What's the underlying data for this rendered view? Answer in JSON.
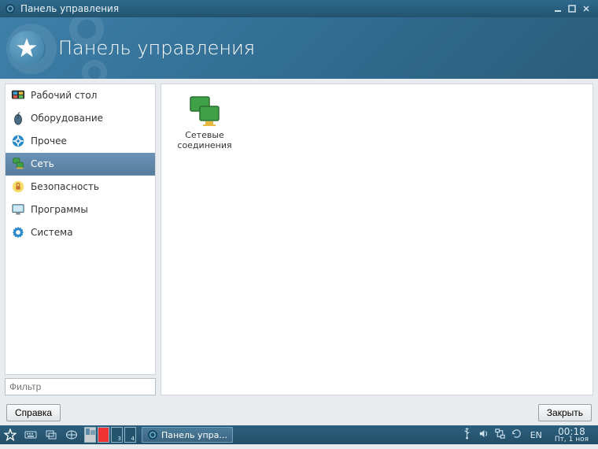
{
  "window": {
    "title": "Панель управления"
  },
  "banner": {
    "title": "Панель управления"
  },
  "sidebar": {
    "items": [
      {
        "label": "Рабочий стол",
        "icon": "desktop-icon"
      },
      {
        "label": "Оборудование",
        "icon": "mouse-icon"
      },
      {
        "label": "Прочее",
        "icon": "gear-icon"
      },
      {
        "label": "Сеть",
        "icon": "network-icon",
        "active": true
      },
      {
        "label": "Безопасность",
        "icon": "shield-icon"
      },
      {
        "label": "Программы",
        "icon": "display-icon"
      },
      {
        "label": "Система",
        "icon": "cog-icon"
      }
    ],
    "filter_placeholder": "Фильтр"
  },
  "main": {
    "items": [
      {
        "label_line1": "Сетевые",
        "label_line2": "соединения"
      }
    ]
  },
  "buttons": {
    "help": "Справка",
    "close": "Закрыть"
  },
  "taskbar": {
    "active_task": "Панель упра...",
    "lang": "EN",
    "time": "00:18",
    "date": "Пт, 1 ноя"
  }
}
